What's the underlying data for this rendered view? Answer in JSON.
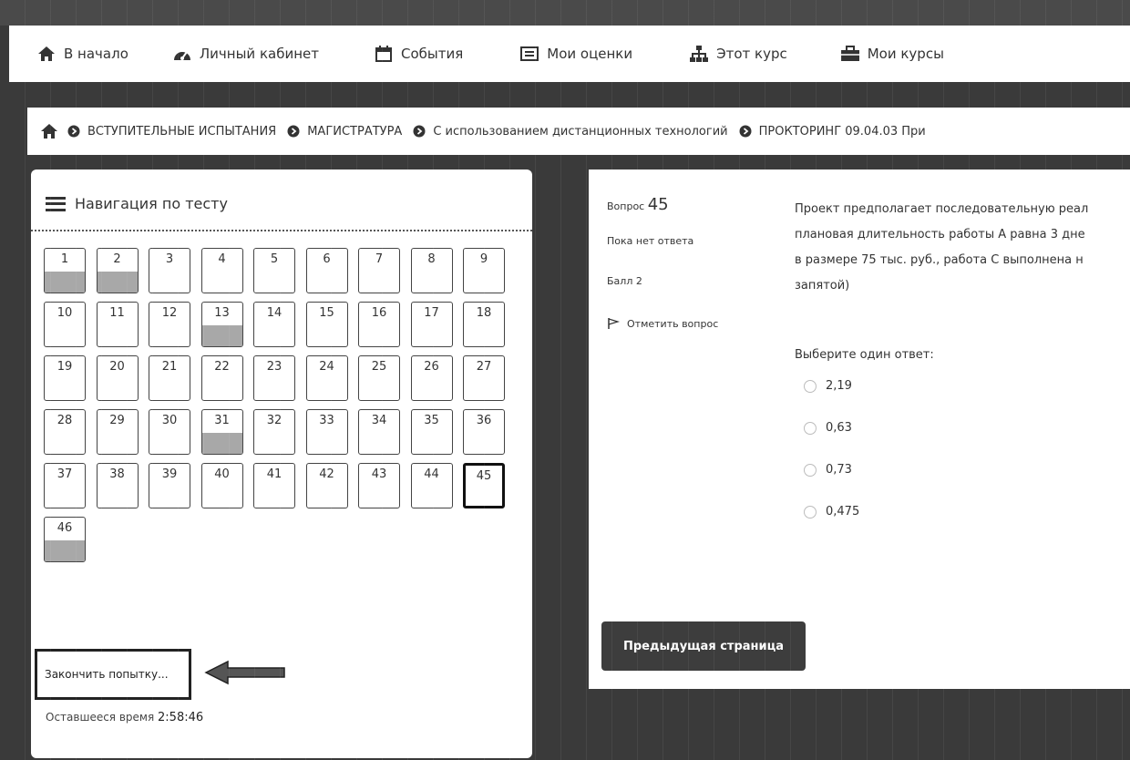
{
  "topnav": {
    "items": [
      {
        "label": "В начало",
        "icon": "home-icon"
      },
      {
        "label": "Личный кабинет",
        "icon": "dashboard-icon"
      },
      {
        "label": "События",
        "icon": "calendar-icon"
      },
      {
        "label": "Мои оценки",
        "icon": "grades-icon"
      },
      {
        "label": "Этот курс",
        "icon": "sitemap-icon"
      },
      {
        "label": "Мои курсы",
        "icon": "briefcase-icon"
      }
    ]
  },
  "breadcrumb": {
    "items": [
      "ВСТУПИТЕЛЬНЫЕ ИСПЫТАНИЯ",
      "МАГИСТРАТУРА",
      "С использованием дистанционных технологий",
      "ПРОКТОРИНГ 09.04.03 При"
    ]
  },
  "quiz_nav": {
    "title": "Навигация по тесту",
    "buttons": [
      {
        "n": "1",
        "answered": true
      },
      {
        "n": "2",
        "answered": true
      },
      {
        "n": "3",
        "answered": false
      },
      {
        "n": "4",
        "answered": false
      },
      {
        "n": "5",
        "answered": false
      },
      {
        "n": "6",
        "answered": false
      },
      {
        "n": "7",
        "answered": false
      },
      {
        "n": "8",
        "answered": false
      },
      {
        "n": "9",
        "answered": false
      },
      {
        "n": "10",
        "answered": false
      },
      {
        "n": "11",
        "answered": false
      },
      {
        "n": "12",
        "answered": false
      },
      {
        "n": "13",
        "answered": true
      },
      {
        "n": "14",
        "answered": false
      },
      {
        "n": "15",
        "answered": false
      },
      {
        "n": "16",
        "answered": false
      },
      {
        "n": "17",
        "answered": false
      },
      {
        "n": "18",
        "answered": false
      },
      {
        "n": "19",
        "answered": false
      },
      {
        "n": "20",
        "answered": false
      },
      {
        "n": "21",
        "answered": false
      },
      {
        "n": "22",
        "answered": false
      },
      {
        "n": "23",
        "answered": false
      },
      {
        "n": "24",
        "answered": false
      },
      {
        "n": "25",
        "answered": false
      },
      {
        "n": "26",
        "answered": false
      },
      {
        "n": "27",
        "answered": false
      },
      {
        "n": "28",
        "answered": false
      },
      {
        "n": "29",
        "answered": false
      },
      {
        "n": "30",
        "answered": false
      },
      {
        "n": "31",
        "answered": true
      },
      {
        "n": "32",
        "answered": false
      },
      {
        "n": "33",
        "answered": false
      },
      {
        "n": "34",
        "answered": false
      },
      {
        "n": "35",
        "answered": false
      },
      {
        "n": "36",
        "answered": false
      },
      {
        "n": "37",
        "answered": false
      },
      {
        "n": "38",
        "answered": false
      },
      {
        "n": "39",
        "answered": false
      },
      {
        "n": "40",
        "answered": false
      },
      {
        "n": "41",
        "answered": false
      },
      {
        "n": "42",
        "answered": false
      },
      {
        "n": "43",
        "answered": false
      },
      {
        "n": "44",
        "answered": false
      },
      {
        "n": "45",
        "answered": false,
        "current": true
      },
      {
        "n": "46",
        "answered": true
      }
    ],
    "finish_label": "Закончить попытку...",
    "timer_label": "Оставшееся время",
    "timer_value": "2:58:46"
  },
  "question": {
    "label": "Вопрос",
    "number": "45",
    "status": "Пока нет ответа",
    "grade": "Балл 2",
    "flag_label": "Отметить вопрос",
    "text_lines": [
      "Проект предполагает последовательную реал",
      "плановая длительность работы А равна 3 дне",
      "в размере 75 тыс. руб., работа С выполнена н",
      "запятой)"
    ],
    "prompt": "Выберите один ответ:",
    "options": [
      "2,19",
      "0,63",
      "0,73",
      "0,475"
    ],
    "prev_label": "Предыдущая страница"
  },
  "colors": {
    "answered_fill": "#a8a8a8",
    "button_dark": "#3d3d3d"
  }
}
